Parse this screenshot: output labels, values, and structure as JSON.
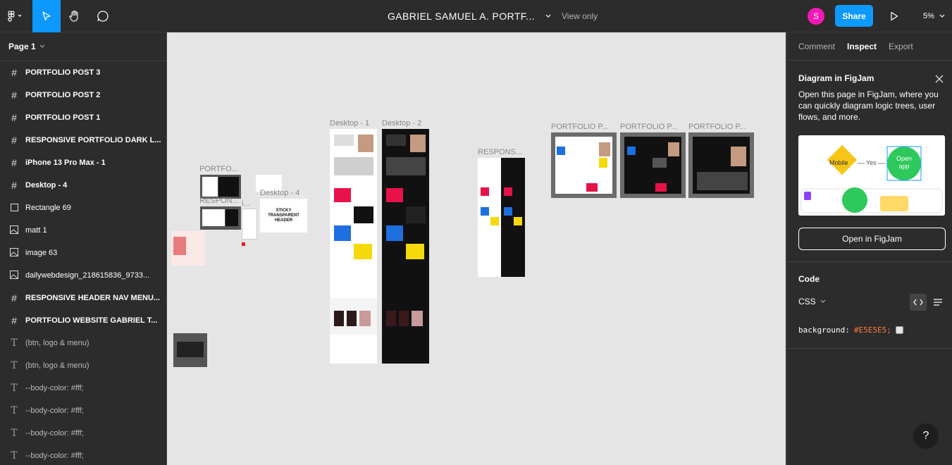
{
  "topbar": {
    "doc_title": "GABRIEL SAMUEL A. PORTF...",
    "view_only": "View only",
    "avatar_letter": "S",
    "share_label": "Share",
    "zoom": "5%"
  },
  "left_panel": {
    "page_label": "Page 1",
    "layers": [
      {
        "icon": "frame-icon",
        "name": "PORTFOLIO POST 3"
      },
      {
        "icon": "frame-icon",
        "name": "PORTFOLIO POST 2"
      },
      {
        "icon": "frame-icon",
        "name": "PORTFOLIO POST 1"
      },
      {
        "icon": "frame-icon",
        "name": "RESPONSIVE PORTFOLIO DARK L..."
      },
      {
        "icon": "frame-icon",
        "name": "iPhone 13 Pro Max - 1"
      },
      {
        "icon": "frame-icon",
        "name": "Desktop - 4"
      },
      {
        "icon": "rectangle-icon",
        "name": "Rectangle 69"
      },
      {
        "icon": "image-icon",
        "name": "matt 1"
      },
      {
        "icon": "image-icon",
        "name": "image 63"
      },
      {
        "icon": "image-icon",
        "name": "dailywebdesign_218615836_9733..."
      },
      {
        "icon": "frame-icon",
        "name": "RESPONSIVE HEADER NAV MENU..."
      },
      {
        "icon": "frame-icon",
        "name": "PORTFOLIO WEBSITE GABRIEL T..."
      },
      {
        "icon": "text-icon",
        "name": "(btn, logo & menu)"
      },
      {
        "icon": "text-icon",
        "name": "(btn, logo & menu)"
      },
      {
        "icon": "text-icon",
        "name": "--body-color: #fff;"
      },
      {
        "icon": "text-icon",
        "name": "--body-color: #fff;"
      },
      {
        "icon": "text-icon",
        "name": "--body-color: #fff;"
      },
      {
        "icon": "text-icon",
        "name": "--body-color: #fff;"
      }
    ]
  },
  "canvas": {
    "background": "#e5e5e5",
    "frame_labels": {
      "portfolio_small": "PORTFO...",
      "respon_small": "RESPON...",
      "dot_label": "i...",
      "desktop4": "Desktop - 4",
      "desktop1": "Desktop - 1",
      "desktop2": "Desktop - 2",
      "responsive": "RESPONS...",
      "post1": "PORTFOLIO P...",
      "post2": "PORTFOLIO P...",
      "post3": "PORTFOLIO P..."
    },
    "sticky_text": "STICKY TRANSPARENT HEADER"
  },
  "right_panel": {
    "tabs": [
      "Comment",
      "Inspect",
      "Export"
    ],
    "active_tab": "Inspect",
    "figjam": {
      "title": "Diagram in FigJam",
      "description": "Open this page in FigJam, where you can quickly diagram logic trees, user flows, and more.",
      "illus_mobile": "Mobile",
      "illus_yes": "Yes",
      "illus_open": "Open app",
      "button": "Open in FigJam"
    },
    "code": {
      "title": "Code",
      "language": "CSS",
      "property": "background:",
      "value": "#E5E5E5;"
    }
  },
  "help_label": "?"
}
